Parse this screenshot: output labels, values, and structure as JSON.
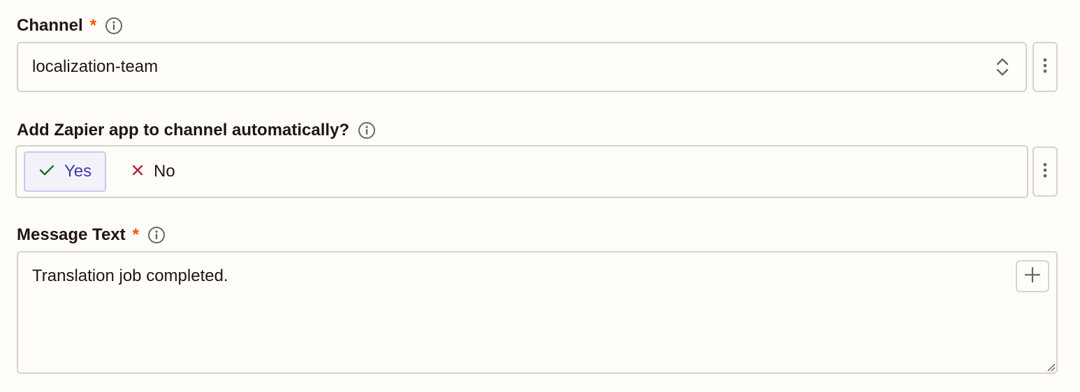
{
  "channel": {
    "label": "Channel",
    "required_mark": "*",
    "value": "localization-team"
  },
  "add_app": {
    "label": "Add Zapier app to channel automatically?",
    "yes_label": "Yes",
    "no_label": "No",
    "selected": "Yes"
  },
  "message": {
    "label": "Message Text",
    "required_mark": "*",
    "value": "Translation job completed."
  },
  "colors": {
    "required": "#ff4f00",
    "selected_text": "#3d39a8",
    "check": "#1f6b2e",
    "cross": "#b3243b",
    "border": "#d7d3c9",
    "background": "#fffdf9"
  },
  "icons": {
    "info": "info-icon",
    "select_arrows": "chevron-updown-icon",
    "more": "kebab-icon",
    "check": "check-icon",
    "cross": "x-icon",
    "add": "plus-icon",
    "resize": "resize-grip-icon"
  }
}
